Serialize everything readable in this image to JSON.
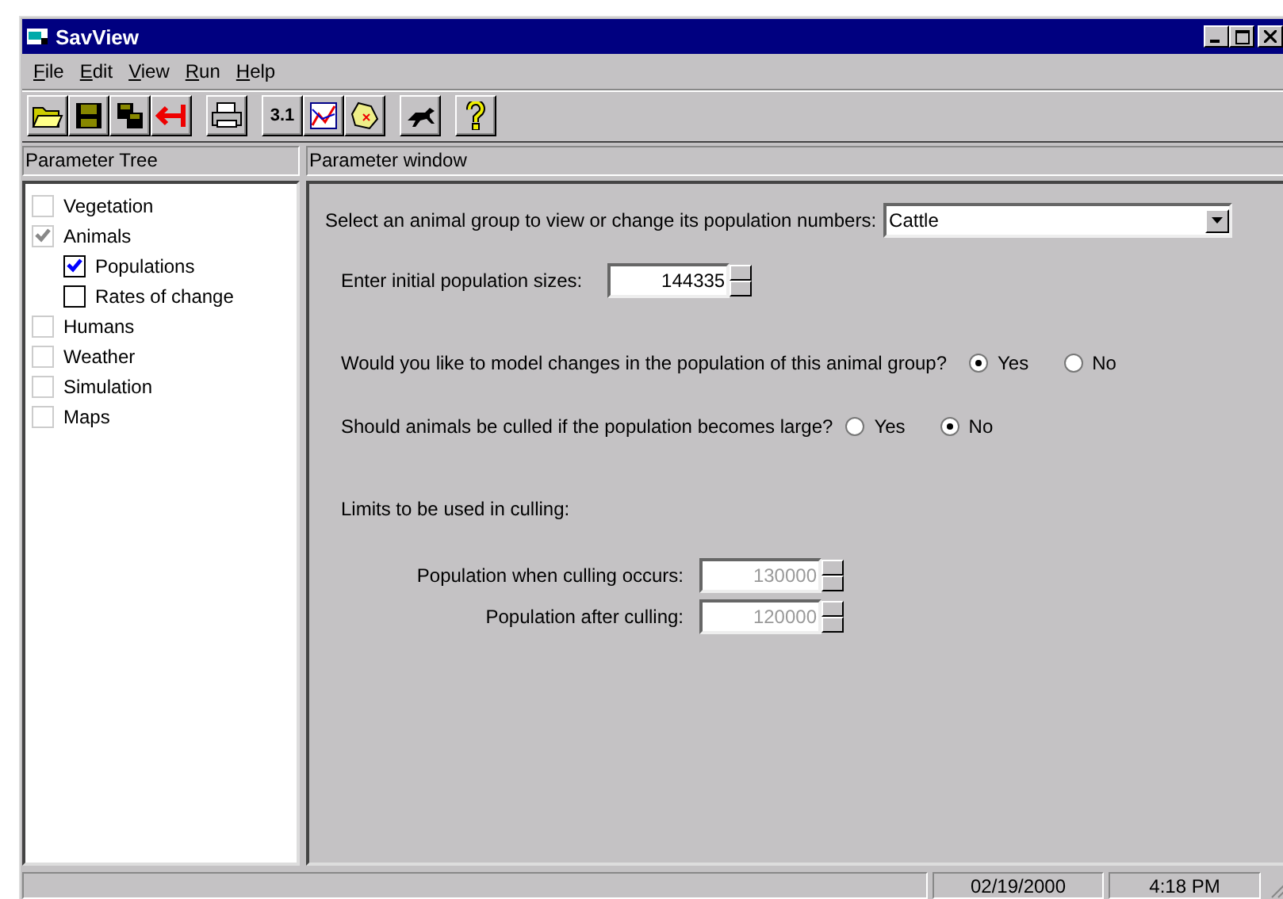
{
  "window": {
    "title": "SavView"
  },
  "menu": [
    "File",
    "Edit",
    "View",
    "Run",
    "Help"
  ],
  "toolbar_groups": [
    [
      {
        "kind": "open"
      },
      {
        "kind": "save"
      },
      {
        "kind": "save-all"
      },
      {
        "kind": "exit"
      }
    ],
    [
      {
        "kind": "print"
      }
    ],
    [
      {
        "kind": "pi",
        "label": "3.1"
      },
      {
        "kind": "graph"
      },
      {
        "kind": "map"
      }
    ],
    [
      {
        "kind": "run"
      }
    ],
    [
      {
        "kind": "help"
      }
    ]
  ],
  "tree_panel": {
    "header": "Parameter Tree",
    "items": [
      {
        "label": "Vegetation",
        "checked": false,
        "enabled": false
      },
      {
        "label": "Animals",
        "checked": true,
        "enabled": false,
        "children": [
          {
            "label": "Populations",
            "checked": true,
            "enabled": true
          },
          {
            "label": "Rates of change",
            "checked": false,
            "enabled": true
          }
        ]
      },
      {
        "label": "Humans",
        "checked": false,
        "enabled": false
      },
      {
        "label": "Weather",
        "checked": false,
        "enabled": false
      },
      {
        "label": "Simulation",
        "checked": false,
        "enabled": false
      },
      {
        "label": "Maps",
        "checked": false,
        "enabled": false
      }
    ]
  },
  "parameter_window": {
    "header": "Parameter window",
    "group_select": {
      "label": "Select an animal group to view or change its population numbers:",
      "value": "Cattle"
    },
    "initial_size": {
      "label": "Enter initial population sizes:",
      "value": "144335",
      "disabled": false
    },
    "questions": [
      {
        "label": "Would you like to model changes in the population of this animal group?",
        "options": [
          {
            "label": "Yes",
            "selected": true
          },
          {
            "label": "No",
            "selected": false
          }
        ]
      },
      {
        "label": "Should animals be culled if the population becomes large?",
        "options": [
          {
            "label": "Yes",
            "selected": false
          },
          {
            "label": "No",
            "selected": true
          }
        ]
      }
    ],
    "limits": {
      "label": "Limits to be used in culling:",
      "fields": [
        {
          "label": "Population when culling occurs:",
          "value": "130000",
          "disabled": true
        },
        {
          "label": "Population after culling:",
          "value": "120000",
          "disabled": true
        }
      ]
    }
  },
  "status_bar": {
    "panels": [
      "02/19/2000",
      "4:18 PM"
    ]
  }
}
